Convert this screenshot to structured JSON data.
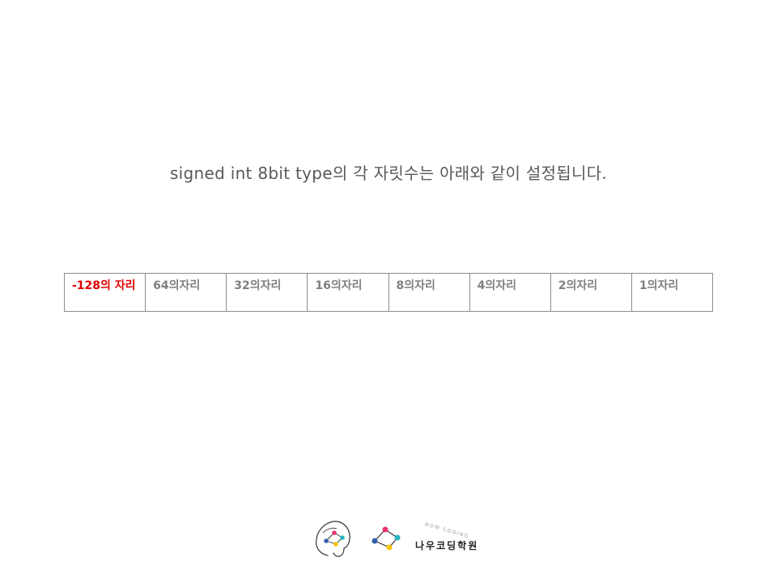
{
  "slide": {
    "title": "signed int 8bit type의 각 자릿수는 아래와 같이 설정됩니다."
  },
  "bit_table": {
    "cells": [
      "-128의 자리",
      "64의자리",
      "32의자리",
      "16의자리",
      "8의자리",
      "4의자리",
      "2의자리",
      "1의자리"
    ],
    "highlight_color": "#e00000",
    "text_color": "#7f7f7f"
  },
  "footer": {
    "brand": "나우코딩학원",
    "tagline": "NOW CODING",
    "icons": [
      "head-logo-icon",
      "network-logo-icon"
    ],
    "accent_colors": [
      "#e8336e",
      "#26b5c0",
      "#f5c200",
      "#2f5fa8"
    ]
  }
}
